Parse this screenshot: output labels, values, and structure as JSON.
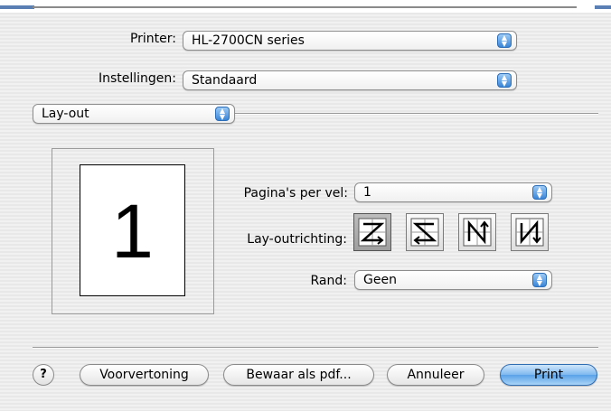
{
  "printer": {
    "label": "Printer:",
    "value": "HL-2700CN series"
  },
  "settings": {
    "label": "Instellingen:",
    "value": "Standaard"
  },
  "panel": {
    "value": "Lay-out"
  },
  "preview": {
    "page_number": "1"
  },
  "layout": {
    "pages_per_sheet": {
      "label": "Pagina's per vel:",
      "value": "1"
    },
    "direction": {
      "label": "Lay-outrichting:",
      "options": [
        "z-direction",
        "reverse-z-direction",
        "n-direction",
        "reverse-n-direction"
      ],
      "selected": 0
    },
    "border": {
      "label": "Rand:",
      "value": "Geen"
    }
  },
  "buttons": {
    "help": "?",
    "preview": "Voorvertoning",
    "save_pdf": "Bewaar als pdf...",
    "cancel": "Annuleer",
    "print": "Print"
  },
  "colors": {
    "accent": "#3a86d8",
    "background": "#ececec"
  }
}
